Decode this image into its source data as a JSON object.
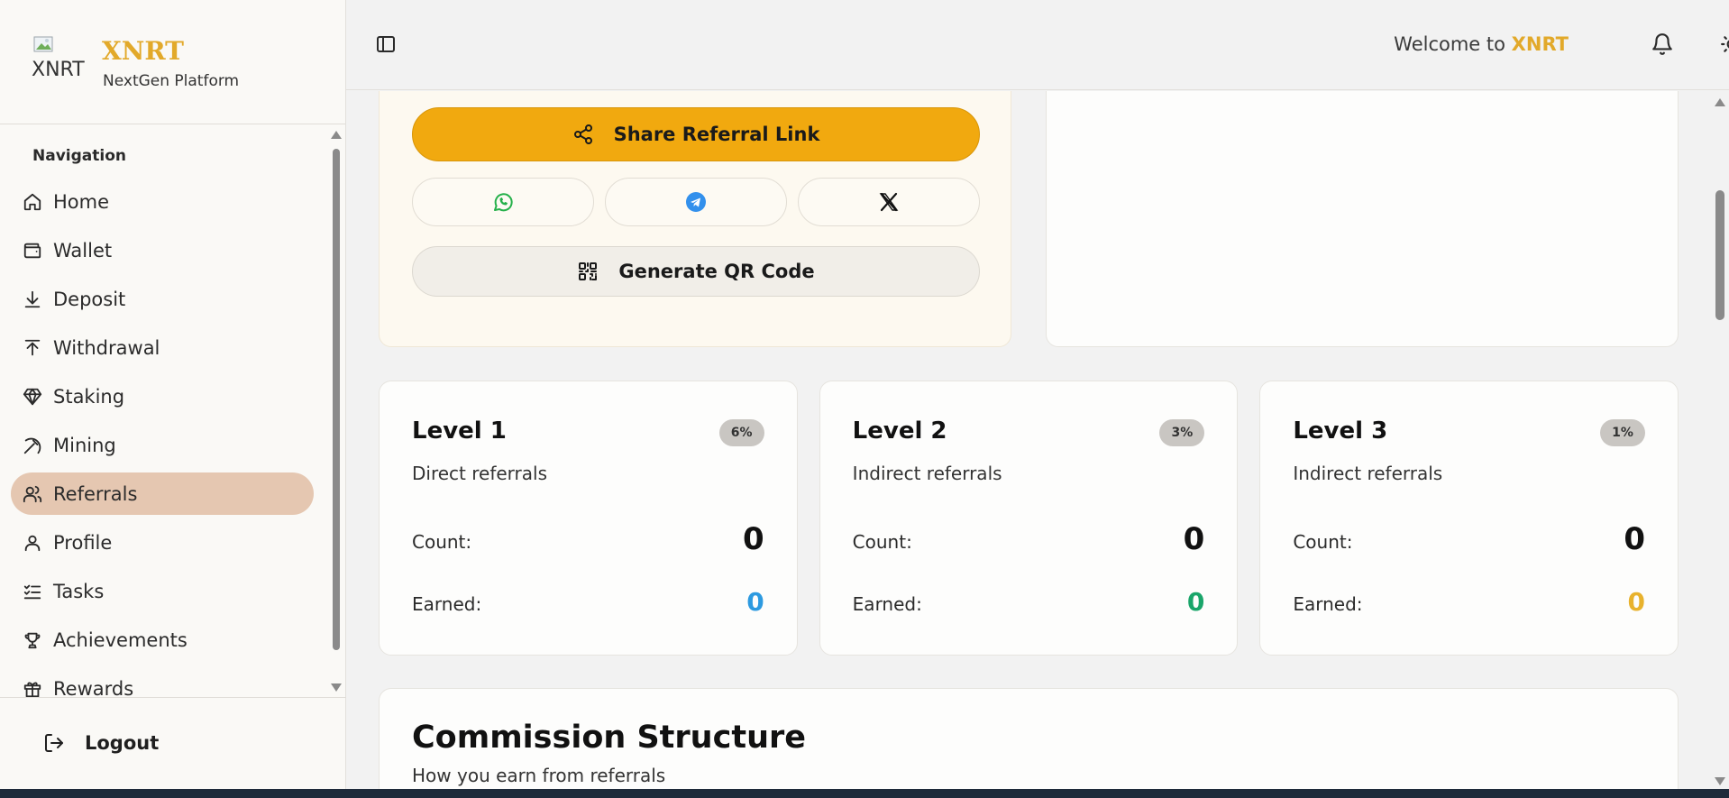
{
  "brand": {
    "logo_alt": "XNRT",
    "name": "XNRT",
    "subtitle": "NextGen Platform"
  },
  "sidebar": {
    "section_title": "Navigation",
    "items": [
      {
        "label": "Home",
        "icon": "home-icon"
      },
      {
        "label": "Wallet",
        "icon": "wallet-icon"
      },
      {
        "label": "Deposit",
        "icon": "download-icon"
      },
      {
        "label": "Withdrawal",
        "icon": "upload-icon"
      },
      {
        "label": "Staking",
        "icon": "gem-icon"
      },
      {
        "label": "Mining",
        "icon": "pickaxe-icon"
      },
      {
        "label": "Referrals",
        "icon": "users-icon",
        "active": true
      },
      {
        "label": "Profile",
        "icon": "user-icon"
      },
      {
        "label": "Tasks",
        "icon": "list-checks-icon"
      },
      {
        "label": "Achievements",
        "icon": "trophy-icon"
      },
      {
        "label": "Rewards",
        "icon": "gift-icon"
      }
    ],
    "logout_label": "Logout"
  },
  "header": {
    "welcome_text": "Welcome to ",
    "welcome_brand": "XNRT"
  },
  "share": {
    "share_label": "Share Referral Link",
    "qr_label": "Generate QR Code",
    "social": [
      "whatsapp-icon",
      "telegram-icon",
      "x-icon"
    ]
  },
  "levels": [
    {
      "title": "Level 1",
      "badge": "6%",
      "description": "Direct referrals",
      "count_label": "Count:",
      "count": "0",
      "earned_label": "Earned:",
      "earned": "0",
      "earned_color": "#2d9ae0"
    },
    {
      "title": "Level 2",
      "badge": "3%",
      "description": "Indirect referrals",
      "count_label": "Count:",
      "count": "0",
      "earned_label": "Earned:",
      "earned": "0",
      "earned_color": "#1aa56a"
    },
    {
      "title": "Level 3",
      "badge": "1%",
      "description": "Indirect referrals",
      "count_label": "Count:",
      "count": "0",
      "earned_label": "Earned:",
      "earned": "0",
      "earned_color": "#e8b22d"
    }
  ],
  "commission": {
    "title": "Commission Structure",
    "subtitle": "How you earn from referrals"
  },
  "colors": {
    "accent": "#f1a90f",
    "active_nav": "#e5c7b1",
    "brand_gold": "#e2a92a"
  }
}
